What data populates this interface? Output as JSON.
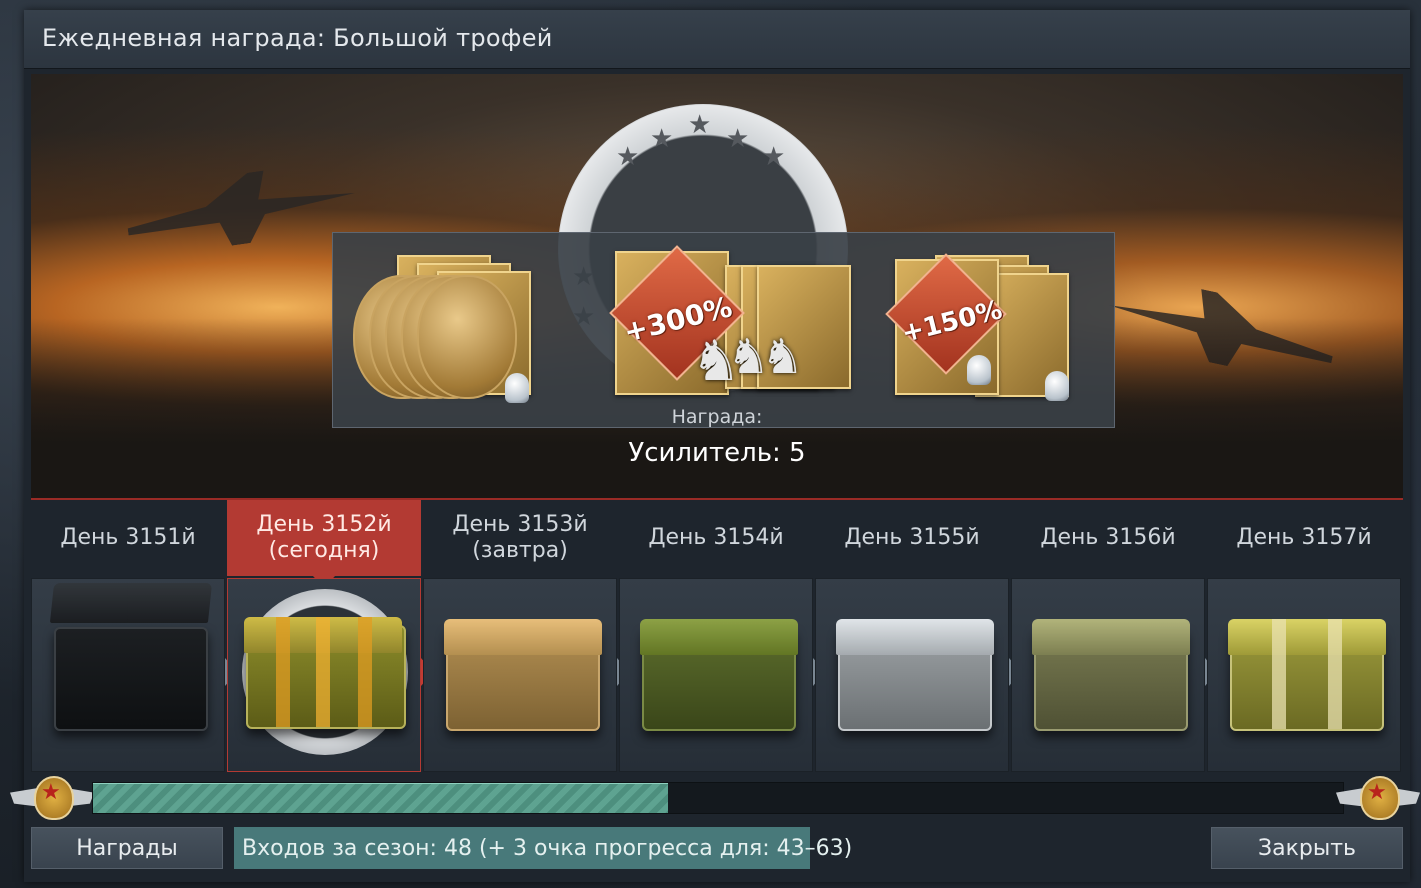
{
  "window": {
    "title": "Ежедневная награда: Большой трофей"
  },
  "hero": {
    "reward_caption": "Награда:",
    "reward_value": "Усилитель: 5",
    "items": [
      {
        "icon": "gold-booster-coins-icon",
        "label": ""
      },
      {
        "icon": "silver-lion-booster-cards-icon",
        "label": "+300%"
      },
      {
        "icon": "research-booster-card-icon",
        "label": "+150%"
      }
    ]
  },
  "days": [
    {
      "label": "День 3151й",
      "state": "past",
      "chest": "opened-black-chest-icon"
    },
    {
      "label": "День 3152й\n(сегодня)",
      "state": "today",
      "chest": "gold-striped-chest-icon"
    },
    {
      "label": "День 3153й\n(завтра)",
      "state": "future",
      "chest": "tan-chest-icon"
    },
    {
      "label": "День 3154й",
      "state": "future",
      "chest": "green-chest-icon"
    },
    {
      "label": "День 3155й",
      "state": "future",
      "chest": "silver-chest-icon"
    },
    {
      "label": "День 3156й",
      "state": "future",
      "chest": "olive-chest-icon"
    },
    {
      "label": "День 3157й",
      "state": "future",
      "chest": "gold-striped-chest-icon"
    }
  ],
  "progress": {
    "fraction": 0.46
  },
  "footer": {
    "rewards_button": "Награды",
    "status_text": "Входов за сезон: 48 (+ 3 очка прогресса для: 43–63)",
    "close_button": "Закрыть"
  },
  "colors": {
    "accent_red": "#b33a33",
    "progress_green": "#5ea391",
    "status_bg": "#48797a"
  }
}
